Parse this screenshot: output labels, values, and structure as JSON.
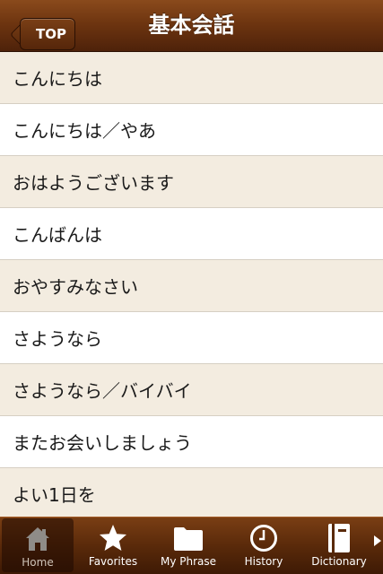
{
  "navbar": {
    "back_label": "TOP",
    "title": "基本会話"
  },
  "phrases": [
    "こんにちは",
    "こんにちは／やあ",
    "おはようございます",
    "こんばんは",
    "おやすみなさい",
    "さようなら",
    "さようなら／バイバイ",
    "またお会いしましょう",
    "よい1日を"
  ],
  "tabs": [
    {
      "label": "Home",
      "icon": "home-icon",
      "active": true
    },
    {
      "label": "Favorites",
      "icon": "star-icon",
      "active": false
    },
    {
      "label": "My Phrase",
      "icon": "folder-icon",
      "active": false
    },
    {
      "label": "History",
      "icon": "clock-icon",
      "active": false
    },
    {
      "label": "Dictionary",
      "icon": "book-icon",
      "active": false
    }
  ],
  "colors": {
    "nav_brown": "#6e3510",
    "row_alt": "#f3ece0",
    "row_plain": "#ffffff"
  }
}
